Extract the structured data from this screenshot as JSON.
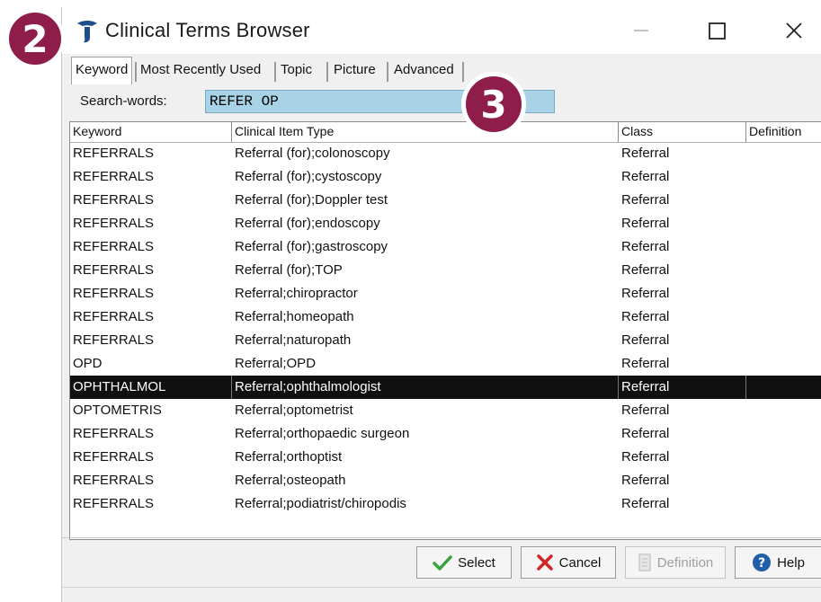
{
  "window": {
    "title": "Clinical Terms Browser"
  },
  "tabs": [
    {
      "label": "Keyword",
      "active": true
    },
    {
      "label": "Most Recently Used",
      "active": false
    },
    {
      "label": "Topic",
      "active": false
    },
    {
      "label": "Picture",
      "active": false
    },
    {
      "label": "Advanced",
      "active": false
    }
  ],
  "search": {
    "label": "Search-words:",
    "value": "REFER OP"
  },
  "columns": [
    "Keyword",
    "Clinical Item Type",
    "Class",
    "Definition"
  ],
  "rows": [
    {
      "keyword": "REFERRALS",
      "type": "Referral (for);colonoscopy",
      "class": "Referral"
    },
    {
      "keyword": "REFERRALS",
      "type": "Referral (for);cystoscopy",
      "class": "Referral"
    },
    {
      "keyword": "REFERRALS",
      "type": "Referral (for);Doppler test",
      "class": "Referral"
    },
    {
      "keyword": "REFERRALS",
      "type": "Referral (for);endoscopy",
      "class": "Referral"
    },
    {
      "keyword": "REFERRALS",
      "type": "Referral (for);gastroscopy",
      "class": "Referral"
    },
    {
      "keyword": "REFERRALS",
      "type": "Referral (for);TOP",
      "class": "Referral"
    },
    {
      "keyword": "REFERRALS",
      "type": "Referral;chiropractor",
      "class": "Referral"
    },
    {
      "keyword": "REFERRALS",
      "type": "Referral;homeopath",
      "class": "Referral"
    },
    {
      "keyword": "REFERRALS",
      "type": "Referral;naturopath",
      "class": "Referral"
    },
    {
      "keyword": "OPD",
      "type": "Referral;OPD",
      "class": "Referral"
    },
    {
      "keyword": "OPHTHALMOL",
      "type": "Referral;ophthalmologist",
      "class": "Referral",
      "selected": true
    },
    {
      "keyword": "OPTOMETRIS",
      "type": "Referral;optometrist",
      "class": "Referral"
    },
    {
      "keyword": "REFERRALS",
      "type": "Referral;orthopaedic surgeon",
      "class": "Referral"
    },
    {
      "keyword": "REFERRALS",
      "type": "Referral;orthoptist",
      "class": "Referral"
    },
    {
      "keyword": "REFERRALS",
      "type": "Referral;osteopath",
      "class": "Referral"
    },
    {
      "keyword": "REFERRALS",
      "type": "Referral;podiatrist/chiropodis",
      "class": "Referral"
    }
  ],
  "buttons": {
    "select": "Select",
    "cancel": "Cancel",
    "definition": "Definition",
    "help": "Help"
  },
  "badges": {
    "step2": "2",
    "step3": "3"
  },
  "colors": {
    "accent_badge": "#8e1d4a",
    "search_bg": "#a8d3e6",
    "selected_row": "#101010",
    "app_icon": "#1f4e8c"
  },
  "icons": {
    "app": "telstra-t-icon",
    "minimize": "minimize-icon",
    "maximize": "maximize-icon",
    "close": "close-icon",
    "select": "checkmark-icon",
    "cancel": "x-icon",
    "definition": "document-icon",
    "help": "help-icon"
  }
}
